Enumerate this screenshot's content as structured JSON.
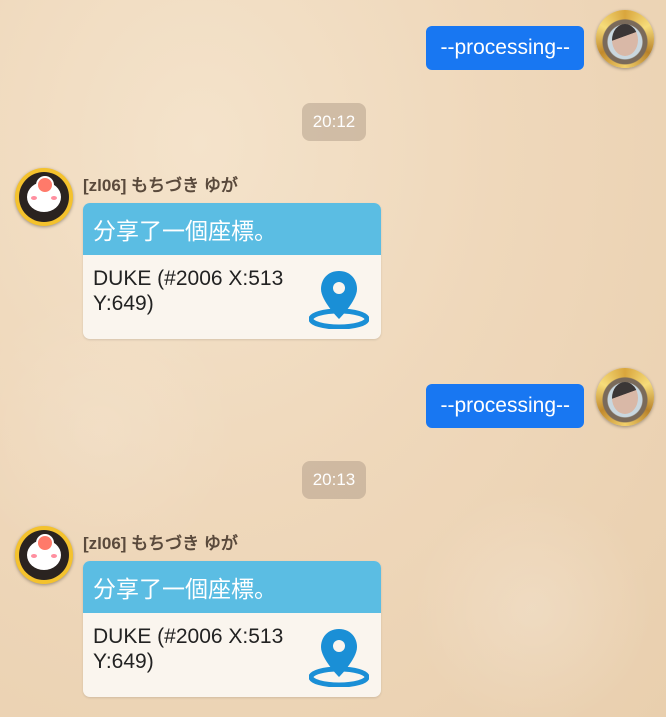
{
  "messages": [
    {
      "type": "outgoing",
      "text": "--processing--"
    },
    {
      "type": "timestamp",
      "text": "20:12"
    },
    {
      "type": "incoming",
      "sender": "[zl06] もちづき ゆが",
      "card_title": "分享了一個座標。",
      "card_text": "DUKE (#2006 X:513 Y:649)"
    },
    {
      "type": "outgoing",
      "text": "--processing--"
    },
    {
      "type": "timestamp",
      "text": "20:13"
    },
    {
      "type": "incoming",
      "sender": "[zl06] もちづき ゆが",
      "card_title": "分享了一個座標。",
      "card_text": "DUKE (#2006 X:513 Y:649)"
    }
  ],
  "colors": {
    "outgoing_bubble": "#1877f2",
    "card_header": "#5bbde3",
    "pin": "#1a8fd6"
  },
  "icons": {
    "location_pin": "location-pin-icon",
    "self_avatar": "player-avatar-gold-frame",
    "other_avatar": "player-avatar-cloud"
  }
}
